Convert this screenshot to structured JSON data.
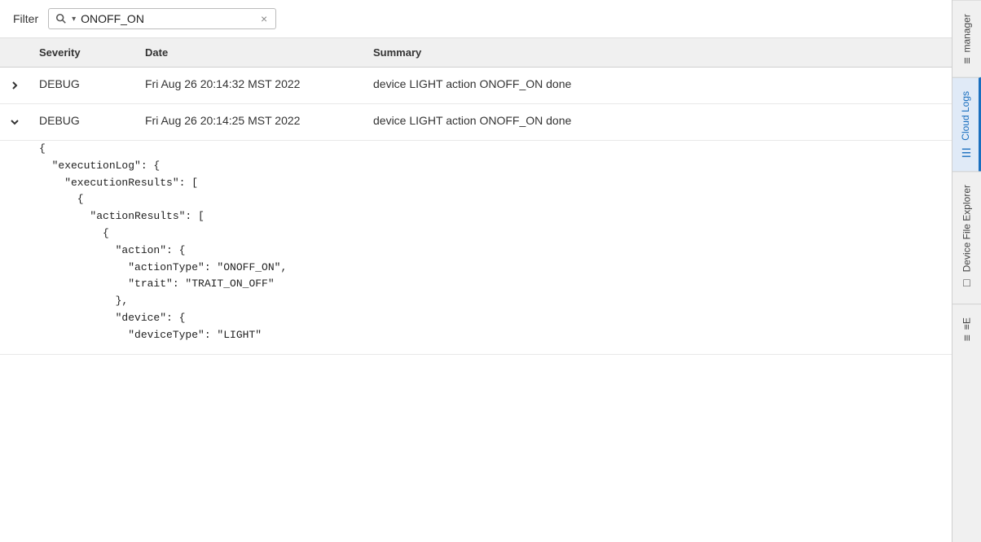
{
  "filter": {
    "label": "Filter",
    "placeholder": "ONOFF_ON",
    "value": "ONOFF_ON",
    "search_icon": "search",
    "clear_icon": "×"
  },
  "table": {
    "columns": [
      {
        "key": "expander",
        "label": ""
      },
      {
        "key": "severity",
        "label": "Severity"
      },
      {
        "key": "date",
        "label": "Date"
      },
      {
        "key": "summary",
        "label": "Summary"
      }
    ],
    "rows": [
      {
        "id": "row1",
        "expanded": false,
        "severity": "DEBUG",
        "date": "Fri Aug 26 20:14:32 MST 2022",
        "summary": "device LIGHT action ONOFF_ON done",
        "detail": null
      },
      {
        "id": "row2",
        "expanded": true,
        "severity": "DEBUG",
        "date": "Fri Aug 26 20:14:25 MST 2022",
        "summary": "device LIGHT action ONOFF_ON done",
        "detail": "{\n  \"executionLog\": {\n    \"executionResults\": [\n      {\n        \"actionResults\": [\n          {\n            \"action\": {\n              \"actionType\": \"ONOFF_ON\",\n              \"trait\": \"TRAIT_ON_OFF\"\n            },\n            \"device\": {\n              \"deviceType\": \"LIGHT\""
      }
    ]
  },
  "sidebar": {
    "tabs": [
      {
        "id": "manager",
        "label": "manager",
        "icon": "≡",
        "active": false
      },
      {
        "id": "cloud-logs",
        "label": "Cloud Logs",
        "icon": "☰",
        "active": true
      },
      {
        "id": "device-file-explorer",
        "label": "Device File Explorer",
        "icon": "□",
        "active": false
      },
      {
        "id": "bottom-tab",
        "label": "≡E",
        "icon": "≡E",
        "active": false
      }
    ]
  }
}
